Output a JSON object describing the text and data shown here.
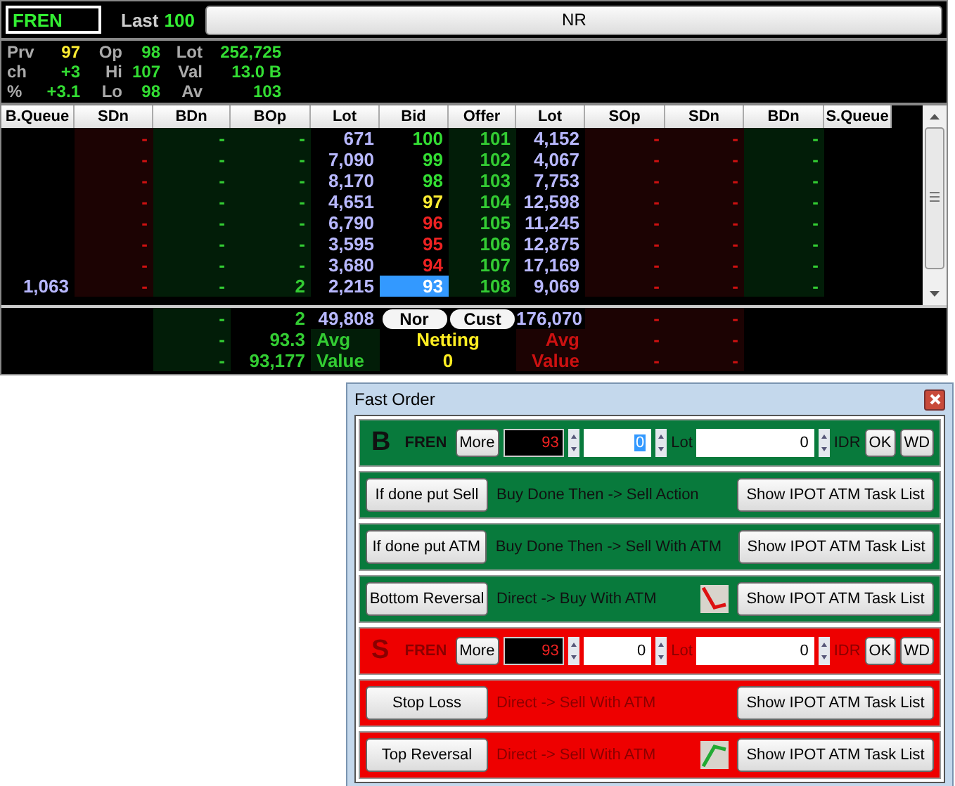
{
  "quote": {
    "symbol": "FREN",
    "last_label": "Last",
    "last": "100",
    "board_button": "NR"
  },
  "stats": [
    [
      {
        "label": "Prv",
        "value": "97",
        "color": "#ffee33"
      },
      {
        "label": "Op",
        "value": "98",
        "color": "#33dd33"
      },
      {
        "label": "Lot",
        "value": "252,725",
        "color": "#33dd33"
      }
    ],
    [
      {
        "label": "ch",
        "value": "+3",
        "color": "#33dd33"
      },
      {
        "label": "Hi",
        "value": "107",
        "color": "#33dd33"
      },
      {
        "label": "Val",
        "value": "13.0 B",
        "color": "#33dd33"
      }
    ],
    [
      {
        "label": "%",
        "value": "+3.1",
        "color": "#33dd33"
      },
      {
        "label": "Lo",
        "value": "98",
        "color": "#33dd33"
      },
      {
        "label": "Av",
        "value": "103",
        "color": "#33dd33"
      }
    ]
  ],
  "depth": {
    "columns": [
      "B.Queue",
      "SDn",
      "BDn",
      "BOp",
      "Lot",
      "Bid",
      "Offer",
      "Lot",
      "SOp",
      "SDn",
      "BDn",
      "S.Queue"
    ],
    "rows": [
      {
        "sdn": "-",
        "bdn": "-",
        "bop": "-",
        "lot": "671",
        "bid": "100",
        "color": "#33dd33",
        "offer": "101",
        "offer_lot": "4,152",
        "sop": "-",
        "s_sdn": "-",
        "s_bdn": "-",
        "selected": false
      },
      {
        "sdn": "-",
        "bdn": "-",
        "bop": "-",
        "lot": "7,090",
        "bid": "99",
        "color": "#33dd33",
        "offer": "102",
        "offer_lot": "4,067",
        "sop": "-",
        "s_sdn": "-",
        "s_bdn": "-",
        "selected": false
      },
      {
        "sdn": "-",
        "bdn": "-",
        "bop": "-",
        "lot": "8,170",
        "bid": "98",
        "color": "#33dd33",
        "offer": "103",
        "offer_lot": "7,753",
        "sop": "-",
        "s_sdn": "-",
        "s_bdn": "-",
        "selected": false
      },
      {
        "sdn": "-",
        "bdn": "-",
        "bop": "-",
        "lot": "4,651",
        "bid": "97",
        "color": "#ffee33",
        "offer": "104",
        "offer_lot": "12,598",
        "sop": "-",
        "s_sdn": "-",
        "s_bdn": "-",
        "selected": false
      },
      {
        "sdn": "-",
        "bdn": "-",
        "bop": "-",
        "lot": "6,790",
        "bid": "96",
        "color": "#ee2222",
        "offer": "105",
        "offer_lot": "11,245",
        "sop": "-",
        "s_sdn": "-",
        "s_bdn": "-",
        "selected": false
      },
      {
        "sdn": "-",
        "bdn": "-",
        "bop": "-",
        "lot": "3,595",
        "bid": "95",
        "color": "#ee2222",
        "offer": "106",
        "offer_lot": "12,875",
        "sop": "-",
        "s_sdn": "-",
        "s_bdn": "-",
        "selected": false
      },
      {
        "sdn": "-",
        "bdn": "-",
        "bop": "-",
        "lot": "3,680",
        "bid": "94",
        "color": "#ee2222",
        "offer": "107",
        "offer_lot": "17,169",
        "sop": "-",
        "s_sdn": "-",
        "s_bdn": "-",
        "selected": false
      },
      {
        "b_queue": "1,063",
        "sdn": "-",
        "bdn": "-",
        "bop": "2",
        "lot": "2,215",
        "bid": "93",
        "offer": "108",
        "offer_lot": "9,069",
        "sop": "-",
        "s_sdn": "-",
        "s_bdn": "-",
        "selected": true
      }
    ],
    "summary": [
      {
        "bdn": "-",
        "bop": "2",
        "lot": "49,808",
        "buttons": [
          "Nor",
          "Cust"
        ],
        "offer_lot": "176,070",
        "sop": "-",
        "s_sdn": "-"
      },
      {
        "bdn": "-",
        "bop": "93.3",
        "buy_label": "Avg",
        "center": "Netting",
        "sell_label": "Avg",
        "sop": "-",
        "s_sdn": "-"
      },
      {
        "bdn": "-",
        "bop": "93,177",
        "buy_label": "Value",
        "center": "0",
        "sell_label": "Value",
        "sop": "-",
        "s_sdn": "-"
      }
    ]
  },
  "fast_order": {
    "title": "Fast Order",
    "panels": [
      {
        "kind": "order",
        "color": "#087a3c",
        "side_label": "B",
        "symbol": "FREN",
        "more": "More",
        "price": "93",
        "qty": "0",
        "qty_highlighted": true,
        "qty_unit": "Lot",
        "amount": "0",
        "currency": "IDR",
        "ok": "OK",
        "wd": "WD"
      },
      {
        "kind": "strategy",
        "color": "#087a3c",
        "button": "If done put Sell",
        "description": "Buy Done Then -> Sell Action",
        "task_button": "Show IPOT ATM Task List"
      },
      {
        "kind": "strategy",
        "color": "#087a3c",
        "button": "If done put ATM",
        "description": "Buy Done Then -> Sell With ATM",
        "task_button": "Show IPOT ATM Task List"
      },
      {
        "kind": "strategy",
        "color": "#087a3c",
        "button": "Bottom Reversal",
        "description": "Direct -> Buy With ATM",
        "task_button": "Show IPOT ATM Task List"
      },
      {
        "kind": "order",
        "color": "#ee0000",
        "side_label": "S",
        "symbol": "FREN",
        "more": "More",
        "price": "93",
        "qty": "0",
        "qty_highlighted": false,
        "qty_unit": "Lot",
        "amount": "0",
        "currency": "IDR",
        "ok": "OK",
        "wd": "WD"
      },
      {
        "kind": "strategy",
        "color": "#ee0000",
        "button": "Stop Loss",
        "description": "Direct -> Sell With ATM",
        "task_button": "Show IPOT ATM Task List"
      },
      {
        "kind": "strategy",
        "color": "#ee0000",
        "button": "Top Reversal",
        "description": "Direct -> Sell With ATM",
        "task_button": "Show IPOT ATM Task List"
      }
    ]
  }
}
